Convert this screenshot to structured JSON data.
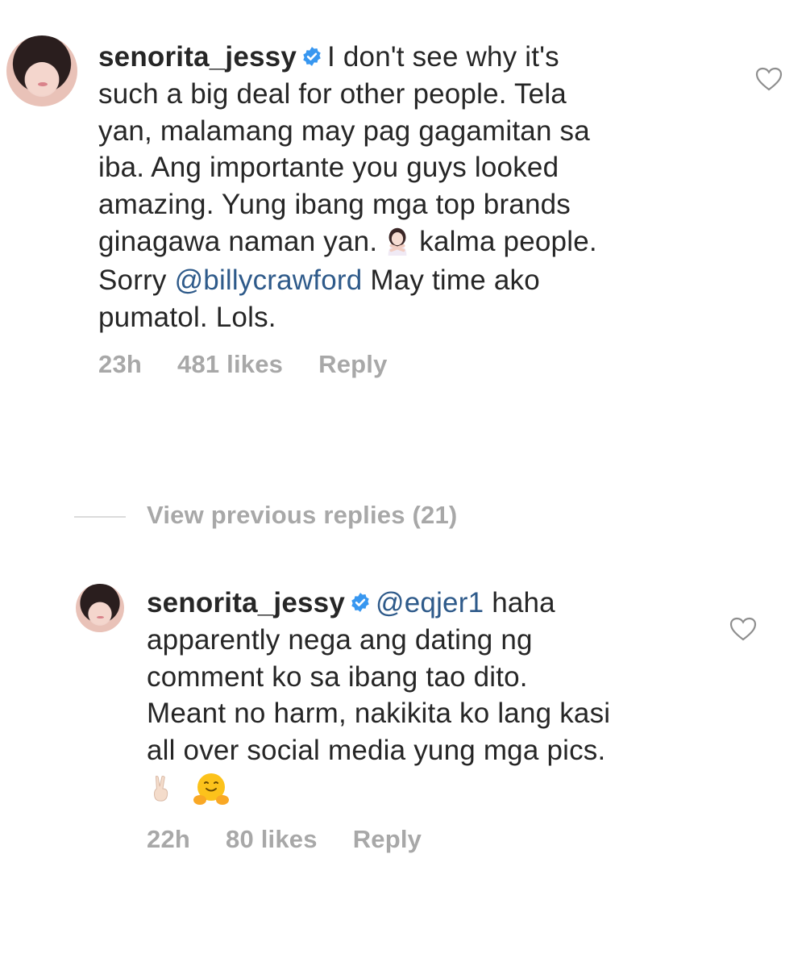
{
  "comment": {
    "username": "senorita_jessy",
    "line1": "I don't see why it's",
    "line2": "such a big deal for other people. Tela",
    "line3": "yan, malamang may pag gagamitan sa",
    "line4": "iba. Ang importante you guys looked",
    "line5": "amazing. Yung ibang mga top brands",
    "line6_pre": "ginagawa naman yan.",
    "line6_post": "kalma people.",
    "line7_pre": "Sorry",
    "mention": "@billycrawford",
    "line7_post": "May time ako",
    "line8": "pumatol. Lols.",
    "emoji": "woman-gesturing-no-icon",
    "time": "23h",
    "likes": "481 likes",
    "reply": "Reply"
  },
  "view_previous": "View previous replies (21)",
  "reply": {
    "username": "senorita_jessy",
    "mention": "@eqjer1",
    "line1": "haha",
    "line2": "apparently nega ang dating ng",
    "line3": "comment ko sa ibang tao dito.",
    "line4": "Meant no harm, nakikita ko lang kasi",
    "line5": "all over social media yung mga pics.",
    "emojis": [
      "victory-hand-icon",
      "hugging-face-icon"
    ],
    "time": "22h",
    "likes": "80 likes",
    "reply": "Reply"
  },
  "colors": {
    "text": "#262626",
    "meta": "#a8a8a8",
    "mention": "#2e5a8a",
    "verified": "#3897f0"
  }
}
